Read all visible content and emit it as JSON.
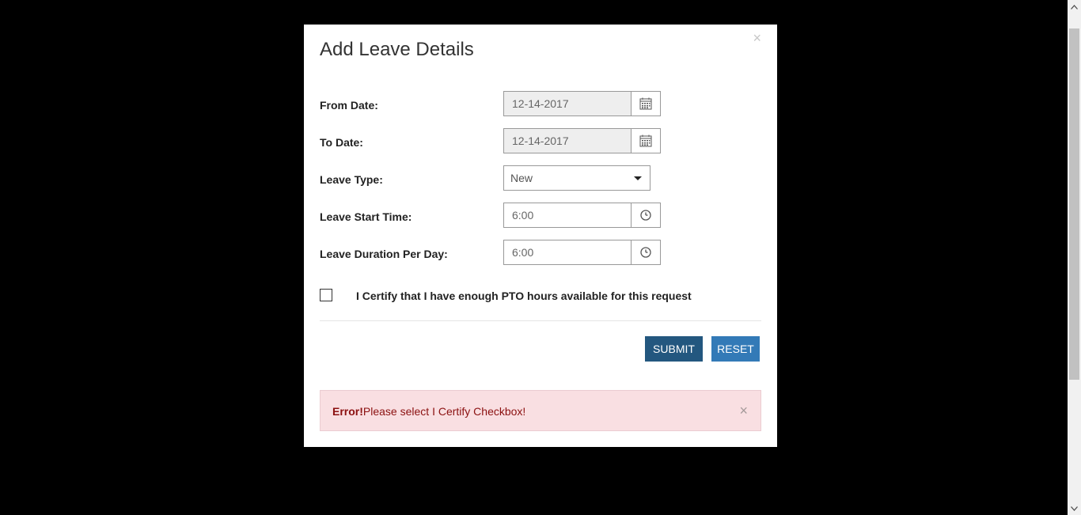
{
  "dialog": {
    "title": "Add Leave Details",
    "close_glyph": "×"
  },
  "form": {
    "from_date": {
      "label": "From Date:",
      "value": "12-14-2017",
      "icon": "calendar-icon"
    },
    "to_date": {
      "label": "To Date:",
      "value": "12-14-2017",
      "icon": "calendar-icon"
    },
    "leave_type": {
      "label": "Leave Type:",
      "value": "New"
    },
    "leave_start_time": {
      "label": "Leave Start Time:",
      "value": "6:00",
      "icon": "clock-icon"
    },
    "leave_duration": {
      "label": "Leave Duration Per Day:",
      "value": "6:00",
      "icon": "clock-icon"
    },
    "certify": {
      "label": "I Certify that I have enough PTO hours available for this request",
      "checked": false
    }
  },
  "buttons": {
    "submit": "SUBMIT",
    "reset": "RESET"
  },
  "alert": {
    "prefix": "Error!",
    "message": "Please select I Certify Checkbox!",
    "close_glyph": "×"
  },
  "colors": {
    "submit_bg": "#23577f",
    "reset_bg": "#337ab7",
    "alert_bg": "#f9dfe2",
    "alert_text": "#8b1010"
  }
}
